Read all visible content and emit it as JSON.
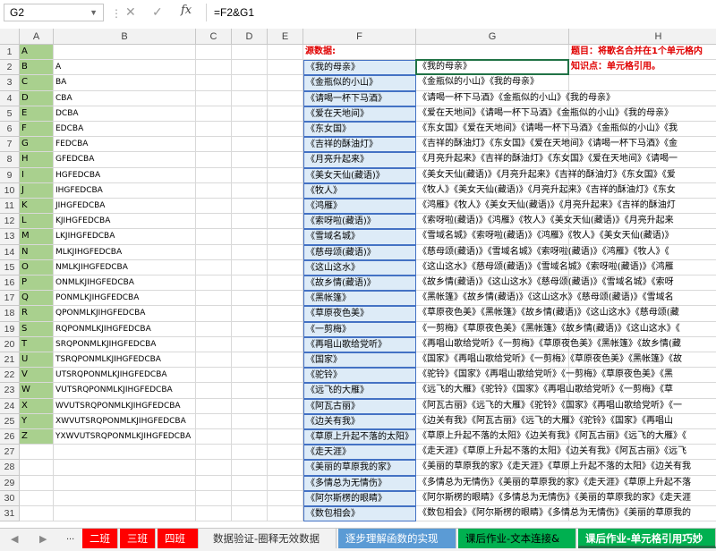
{
  "formula_bar": {
    "name_box": "G2",
    "fx_label": "fx",
    "formula": "=F2&G1"
  },
  "columns": [
    "A",
    "B",
    "C",
    "D",
    "E",
    "F",
    "G",
    "H"
  ],
  "header_labels": {
    "f1": "源数据:",
    "h1": "题目：将歌名合并在1个单元格内",
    "h2": "知识点：单元格引用。"
  },
  "rows": [
    {
      "n": "1",
      "a": "A",
      "b": "",
      "f": "",
      "g": ""
    },
    {
      "n": "2",
      "a": "B",
      "b": "A",
      "f": "《我的母亲》",
      "g": "《我的母亲》"
    },
    {
      "n": "3",
      "a": "C",
      "b": "BA",
      "f": "《金瓶似的小山》",
      "g": "《金瓶似的小山》《我的母亲》"
    },
    {
      "n": "4",
      "a": "D",
      "b": "CBA",
      "f": "《请喝一杯下马酒》",
      "g": "《请喝一杯下马酒》《金瓶似的小山》《我的母亲》"
    },
    {
      "n": "5",
      "a": "E",
      "b": "DCBA",
      "f": "《爱在天地间》",
      "g": "《爱在天地间》《请喝一杯下马酒》《金瓶似的小山》《我的母亲》"
    },
    {
      "n": "6",
      "a": "F",
      "b": "EDCBA",
      "f": "《东女国》",
      "g": "《东女国》《爱在天地间》《请喝一杯下马酒》《金瓶似的小山》《我"
    },
    {
      "n": "7",
      "a": "G",
      "b": "FEDCBA",
      "f": "《吉祥的酥油灯》",
      "g": "《吉祥的酥油灯》《东女国》《爱在天地间》《请喝一杯下马酒》《金"
    },
    {
      "n": "8",
      "a": "H",
      "b": "GFEDCBA",
      "f": "《月亮升起来》",
      "g": "《月亮升起来》《吉祥的酥油灯》《东女国》《爱在天地间》《请喝一"
    },
    {
      "n": "9",
      "a": "I",
      "b": "HGFEDCBA",
      "f": "《美女天仙(藏语)》",
      "g": "《美女天仙(藏语)》《月亮升起来》《吉祥的酥油灯》《东女国》《爱"
    },
    {
      "n": "10",
      "a": "J",
      "b": "IHGFEDCBA",
      "f": "《牧人》",
      "g": "《牧人》《美女天仙(藏语)》《月亮升起来》《吉祥的酥油灯》《东女"
    },
    {
      "n": "11",
      "a": "K",
      "b": "JIHGFEDCBA",
      "f": "《鸿雁》",
      "g": "《鸿雁》《牧人》《美女天仙(藏语)》《月亮升起来》《吉祥的酥油灯"
    },
    {
      "n": "12",
      "a": "L",
      "b": "KJIHGFEDCBA",
      "f": "《索呀啦(藏语)》",
      "g": "《索呀啦(藏语)》《鸿雁》《牧人》《美女天仙(藏语)》《月亮升起来"
    },
    {
      "n": "13",
      "a": "M",
      "b": "LKJIHGFEDCBA",
      "f": "《雪域名城》",
      "g": "《雪域名城》《索呀啦(藏语)》《鸿雁》《牧人》《美女天仙(藏语)》"
    },
    {
      "n": "14",
      "a": "N",
      "b": "MLKJIHGFEDCBA",
      "f": "《慈母颂(藏语)》",
      "g": "《慈母颂(藏语)》《雪域名城》《索呀啦(藏语)》《鸿雁》《牧人》《"
    },
    {
      "n": "15",
      "a": "O",
      "b": "NMLKJIHGFEDCBA",
      "f": "《这山这水》",
      "g": "《这山这水》《慈母颂(藏语)》《雪域名城》《索呀啦(藏语)》《鸿雁"
    },
    {
      "n": "16",
      "a": "P",
      "b": "ONMLKJIHGFEDCBA",
      "f": "《故乡情(藏语)》",
      "g": "《故乡情(藏语)》《这山这水》《慈母颂(藏语)》《雪域名城》《索呀"
    },
    {
      "n": "17",
      "a": "Q",
      "b": "PONMLKJIHGFEDCBA",
      "f": "《黑帐篷》",
      "g": "《黑帐篷》《故乡情(藏语)》《这山这水》《慈母颂(藏语)》《雪域名"
    },
    {
      "n": "18",
      "a": "R",
      "b": "QPONMLKJIHGFEDCBA",
      "f": "《草原夜色美》",
      "g": "《草原夜色美》《黑帐篷》《故乡情(藏语)》《这山这水》《慈母颂(藏"
    },
    {
      "n": "19",
      "a": "S",
      "b": "RQPONMLKJIHGFEDCBA",
      "f": "《一剪梅》",
      "g": "《一剪梅》《草原夜色美》《黑帐篷》《故乡情(藏语)》《这山这水》《"
    },
    {
      "n": "20",
      "a": "T",
      "b": "SRQPONMLKJIHGFEDCBA",
      "f": "《再唱山歌给党听》",
      "g": "《再唱山歌给党听》《一剪梅》《草原夜色美》《黑帐篷》《故乡情(藏"
    },
    {
      "n": "21",
      "a": "U",
      "b": "TSRQPONMLKJIHGFEDCBA",
      "f": "《国家》",
      "g": "《国家》《再唱山歌给党听》《一剪梅》《草原夜色美》《黑帐篷》《故"
    },
    {
      "n": "22",
      "a": "V",
      "b": "UTSRQPONMLKJIHGFEDCBA",
      "f": "《驼铃》",
      "g": "《驼铃》《国家》《再唱山歌给党听》《一剪梅》《草原夜色美》《黑"
    },
    {
      "n": "23",
      "a": "W",
      "b": "VUTSRQPONMLKJIHGFEDCBA",
      "f": "《远飞的大雁》",
      "g": "《远飞的大雁》《驼铃》《国家》《再唱山歌给党听》《一剪梅》《草"
    },
    {
      "n": "24",
      "a": "X",
      "b": "WVUTSRQPONMLKJIHGFEDCBA",
      "f": "《阿瓦古丽》",
      "g": "《阿瓦古丽》《远飞的大雁》《驼铃》《国家》《再唱山歌给党听》《一"
    },
    {
      "n": "25",
      "a": "Y",
      "b": "XWVUTSRQPONMLKJIHGFEDCBA",
      "f": "《边关有我》",
      "g": "《边关有我》《阿瓦古丽》《远飞的大雁》《驼铃》《国家》《再唱山"
    },
    {
      "n": "26",
      "a": "Z",
      "b": "YXWVUTSRQPONMLKJIHGFEDCBA",
      "f": "《草原上升起不落的太阳》",
      "g": "《草原上升起不落的太阳》《边关有我》《阿瓦古丽》《远飞的大雁》《"
    },
    {
      "n": "27",
      "a": "",
      "b": "",
      "f": "《走天涯》",
      "g": "《走天涯》《草原上升起不落的太阳》《边关有我》《阿瓦古丽》《远飞"
    },
    {
      "n": "28",
      "a": "",
      "b": "",
      "f": "《美丽的草原我的家》",
      "g": "《美丽的草原我的家》《走天涯》《草原上升起不落的太阳》《边关有我"
    },
    {
      "n": "29",
      "a": "",
      "b": "",
      "f": "《多情总为无情伤》",
      "g": "《多情总为无情伤》《美丽的草原我的家》《走天涯》《草原上升起不落"
    },
    {
      "n": "30",
      "a": "",
      "b": "",
      "f": "《阿尔斯楞的眼睛》",
      "g": "《阿尔斯楞的眼睛》《多情总为无情伤》《美丽的草原我的家》《走天涯"
    },
    {
      "n": "31",
      "a": "",
      "b": "",
      "f": "《数包相会》",
      "g": "《数包相会》《阿尔斯楞的眼睛》《多情总为无情伤》《美丽的草原我的"
    }
  ],
  "sheet_tabs": {
    "ellipsis": "...",
    "tabs": [
      {
        "label": "二班",
        "bg": "#ff0000",
        "fg": "#ffffff"
      },
      {
        "label": "三班",
        "bg": "#ff0000",
        "fg": "#ffffff"
      },
      {
        "label": "四班",
        "bg": "#ff0000",
        "fg": "#ffffff"
      },
      {
        "label": "数据验证-圈释无效数据",
        "bg": "#f2f2f2",
        "fg": "#333333"
      },
      {
        "label": "逐步理解函数的实现",
        "bg": "#5b9bd5",
        "fg": "#ffffff"
      },
      {
        "label": "课后作业-文本连接&",
        "bg": "#00b050",
        "fg": "#000000"
      },
      {
        "label": "课后作业-单元格引用巧妙",
        "bg": "#00b050",
        "fg": "#ffffff"
      }
    ]
  },
  "colors": {
    "green_fill": "#a9d08e",
    "blue_fill": "#ddebf7",
    "blue_border": "#4472c4",
    "red_text": "#e00000"
  }
}
